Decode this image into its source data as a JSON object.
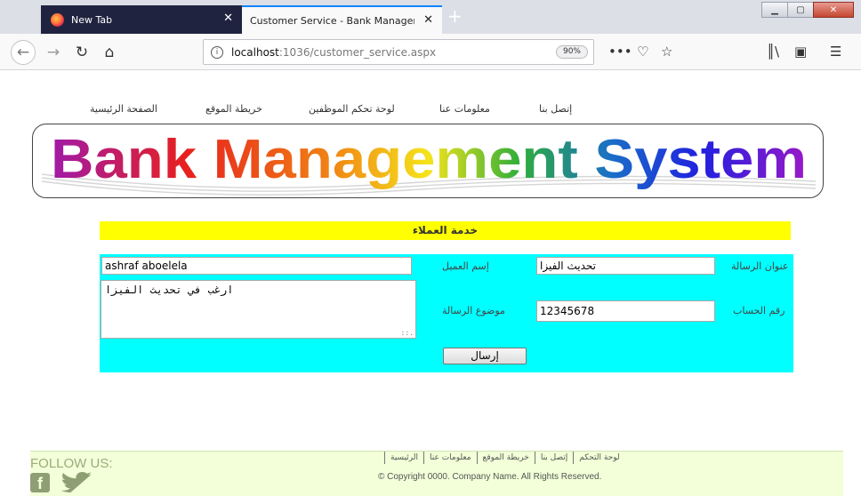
{
  "browser": {
    "tabs": [
      {
        "title": "New Tab"
      },
      {
        "title": "Customer Service - Bank Management Sys"
      }
    ],
    "url_host": "localhost",
    "url_path": ":1036/customer_service.aspx",
    "zoom": "90%"
  },
  "nav": {
    "home": "الصفحة الرئيسية",
    "sitemap": "خريطة الموقع",
    "staff_panel": "لوحة تحكم الموظفين",
    "about": "معلومات عنا",
    "contact": "إتصل بنا"
  },
  "banner": {
    "title": "Bank Management System"
  },
  "section_title": "خدمة العملاء",
  "form": {
    "customer_name_label": "إسم العميل",
    "customer_name_value": "ashraf aboelela",
    "message_title_label": "عنوان الرسالة",
    "message_title_value": "تحديث الفيزا",
    "message_body_label": "موضوع الرسالة",
    "message_body_value": "ارغب في تحديث الفيزا",
    "account_label": "رقم الحساب",
    "account_value": "12345678",
    "send_label": "إرسال"
  },
  "footer": {
    "follow": "FOLLOW US:",
    "links": [
      "لوحة التحكم",
      "إتصل بنا",
      "خريطة الموقع",
      "معلومات عنا",
      "الرئيسية"
    ],
    "copyright": "© Copyright 0000. Company Name. All Rights Reserved."
  },
  "colors": {
    "section_bg": "#ffff00",
    "form_bg": "#00ffff",
    "footer_bg": "#f2ffd8"
  }
}
